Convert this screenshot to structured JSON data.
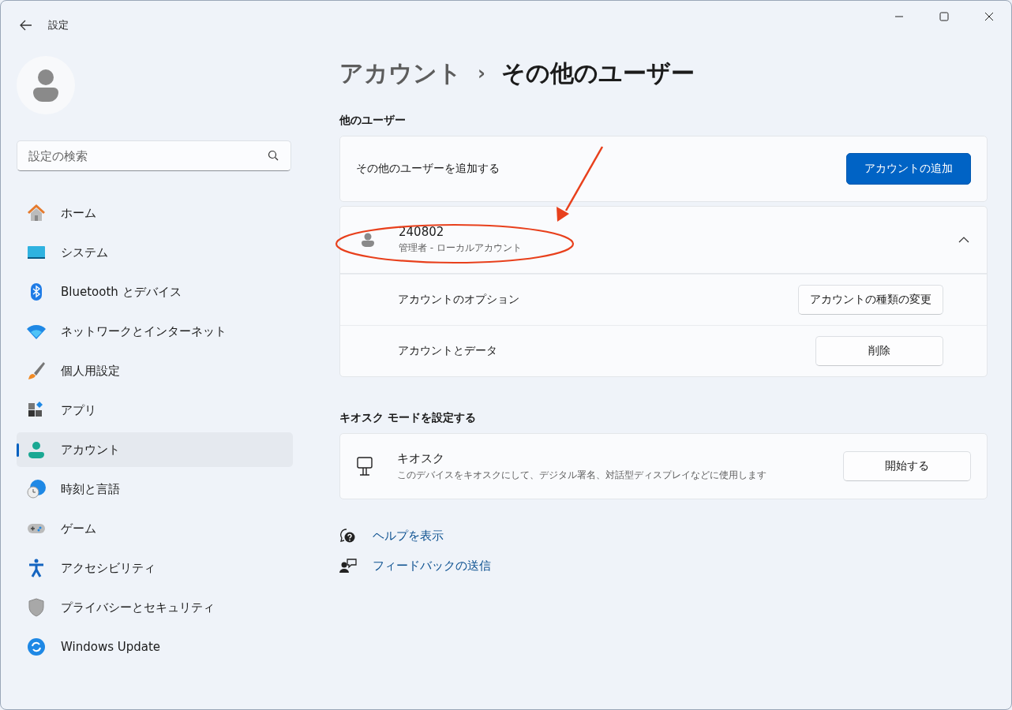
{
  "window": {
    "title": "設定"
  },
  "search": {
    "placeholder": "設定の検索"
  },
  "sidebar": {
    "items": [
      {
        "label": "ホーム",
        "selected": false
      },
      {
        "label": "システム",
        "selected": false
      },
      {
        "label": "Bluetooth とデバイス",
        "selected": false
      },
      {
        "label": "ネットワークとインターネット",
        "selected": false
      },
      {
        "label": "個人用設定",
        "selected": false
      },
      {
        "label": "アプリ",
        "selected": false
      },
      {
        "label": "アカウント",
        "selected": true
      },
      {
        "label": "時刻と言語",
        "selected": false
      },
      {
        "label": "ゲーム",
        "selected": false
      },
      {
        "label": "アクセシビリティ",
        "selected": false
      },
      {
        "label": "プライバシーとセキュリティ",
        "selected": false
      },
      {
        "label": "Windows Update",
        "selected": false
      }
    ]
  },
  "breadcrumb": {
    "parent": "アカウント",
    "separator": "›",
    "current": "その他のユーザー"
  },
  "other_users": {
    "heading": "他のユーザー",
    "add_label": "その他のユーザーを追加する",
    "add_button": "アカウントの追加",
    "user": {
      "name": "240802",
      "subtitle": "管理者 - ローカルアカウント",
      "expanded": true,
      "options": [
        {
          "label": "アカウントのオプション",
          "button": "アカウントの種類の変更"
        },
        {
          "label": "アカウントとデータ",
          "button": "削除"
        }
      ]
    }
  },
  "kiosk": {
    "heading": "キオスク モードを設定する",
    "title": "キオスク",
    "description": "このデバイスをキオスクにして、デジタル署名、対話型ディスプレイなどに使用します",
    "button": "開始する"
  },
  "links": [
    "ヘルプを表示",
    "フィードバックの送信"
  ]
}
